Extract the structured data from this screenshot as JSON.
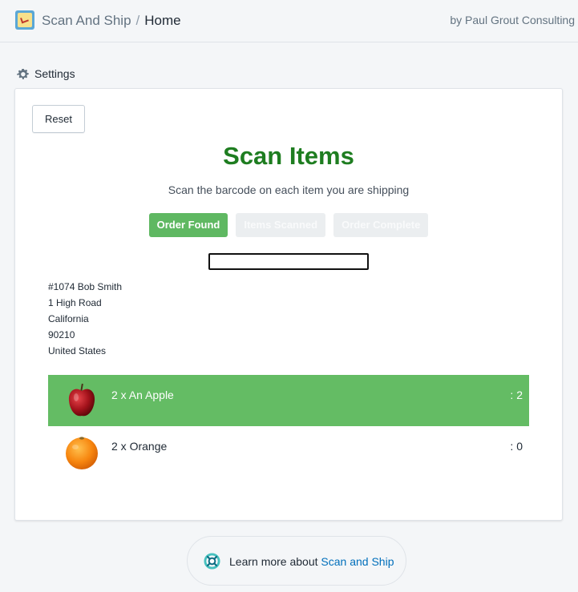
{
  "header": {
    "app_name": "Scan And Ship",
    "separator": "/",
    "page": "Home",
    "byline": "by Paul Grout Consulting"
  },
  "settings": {
    "label": "Settings"
  },
  "card": {
    "reset_label": "Reset",
    "title": "Scan Items",
    "subtitle": "Scan the barcode on each item you are shipping",
    "steps": [
      {
        "label": "Order Found",
        "state": "active"
      },
      {
        "label": "Items Scanned",
        "state": "inactive"
      },
      {
        "label": "Order Complete",
        "state": "inactive"
      }
    ],
    "scan_input": {
      "value": "",
      "placeholder": ""
    },
    "address": {
      "line1": "#1074 Bob Smith",
      "line2": "1 High Road",
      "line3": "California",
      "line4": "90210",
      "line5": "United States"
    },
    "items": [
      {
        "description": "2 x An Apple",
        "count": ": 2",
        "icon": "apple-image",
        "status": "scanned"
      },
      {
        "description": "2 x Orange",
        "count": ": 0",
        "icon": "orange-image",
        "status": "pending"
      }
    ]
  },
  "footer": {
    "prefix": "Learn more about",
    "link_text": "Scan and Ship"
  },
  "colors": {
    "title_green": "#1e7d20",
    "active_step": "#5fb862",
    "scanned_row": "#64bc64",
    "link_blue": "#006fbb",
    "page_bg": "#f4f6f8"
  }
}
